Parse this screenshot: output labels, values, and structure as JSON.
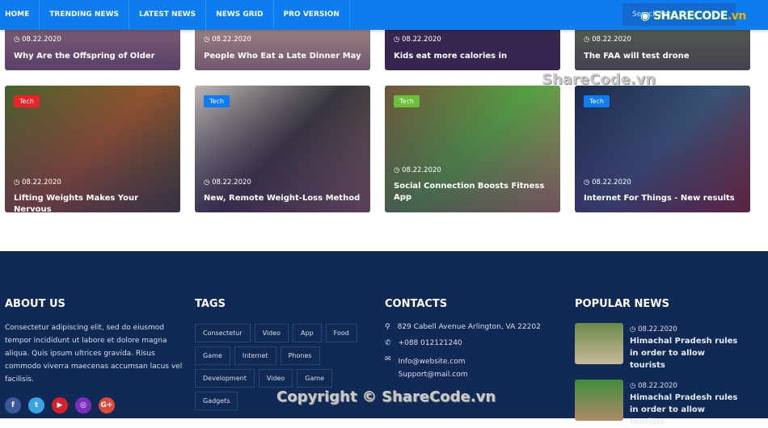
{
  "nav": {
    "items": [
      "HOME",
      "TRENDING NEWS",
      "LATEST NEWS",
      "NEWS GRID",
      "PRO VERSION"
    ],
    "search_placeholder": "Search For",
    "accent": "#0d7cf0"
  },
  "logo": {
    "text": "SHARECODE",
    "suffix": ".vn"
  },
  "top_cards": [
    {
      "date": "08.22.2020",
      "title": "Why Are the Offspring of Older"
    },
    {
      "date": "08.22.2020",
      "title": "People Who Eat a Late Dinner May"
    },
    {
      "date": "08.22.2020",
      "title": "Kids eat more calories in"
    },
    {
      "date": "08.22.2020",
      "title": "The FAA will test drone"
    }
  ],
  "cards": [
    {
      "tag": "Tech",
      "tag_color": "#e8232a",
      "date": "08.22.2020",
      "title": "Lifting Weights Makes Your Nervous"
    },
    {
      "tag": "Tech",
      "tag_color": "#0d7cf0",
      "date": "08.22.2020",
      "title": "New, Remote Weight-Loss Method"
    },
    {
      "tag": "Tech",
      "tag_color": "#6abf3b",
      "date": "08.22.2020",
      "title": "Social Connection Boosts Fitness App"
    },
    {
      "tag": "Tech",
      "tag_color": "#0d7cf0",
      "date": "08.22.2020",
      "title": "Internet For Things - New results"
    }
  ],
  "watermarks": {
    "mid": "ShareCode.vn",
    "copyright": "Copyright © ShareCode.vn"
  },
  "footer": {
    "about": {
      "title": "ABOUT US",
      "text": "Consectetur adipiscing elit, sed do eiusmod tempor incididunt ut labore et dolore magna aliqua. Quis ipsum ultrices gravida. Risus commodo viverra maecenas accumsan lacus vel facilisis.",
      "social": [
        "facebook",
        "twitter",
        "youtube",
        "instagram",
        "google-plus"
      ]
    },
    "tags": {
      "title": "TAGS",
      "items": [
        "Consectetur",
        "Video",
        "App",
        "Food",
        "Game",
        "Internet",
        "Phones",
        "Development",
        "Video",
        "Game",
        "Gadgets"
      ]
    },
    "contacts": {
      "title": "CONTACTS",
      "address": "829 Cabell Avenue Arlington, VA 22202",
      "phone": "+088 012121240",
      "email1": "Info@website.com",
      "email2": "Support@mail.com"
    },
    "popular": {
      "title": "POPULAR NEWS",
      "items": [
        {
          "date": "08.22.2020",
          "title": "Himachal Pradesh rules in order to allow tourists"
        },
        {
          "date": "08.22.2020",
          "title": "Himachal Pradesh rules in order to allow tourists"
        }
      ]
    }
  }
}
